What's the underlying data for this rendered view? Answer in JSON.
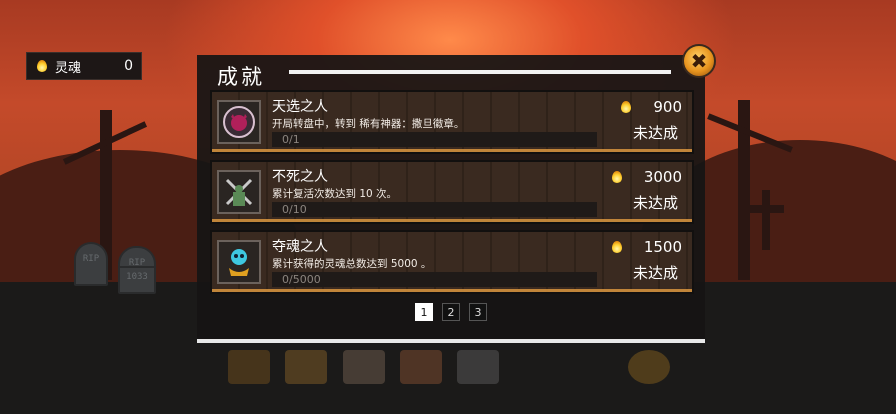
{
  "soul_counter": {
    "label": "灵魂",
    "value": "0",
    "icon": "flame-icon"
  },
  "panel": {
    "title": "成就",
    "close_icon": "close-icon",
    "close_glyph": "✖"
  },
  "achievements": [
    {
      "name": "天选之人",
      "description": "开局转盘中，转到 稀有神器：撒旦徽章。",
      "progress": "0/1",
      "reward": "900",
      "status": "未达成",
      "icon": "satan-badge-icon"
    },
    {
      "name": "不死之人",
      "description": "累计复活次数达到 10 次。",
      "progress": "0/10",
      "reward": "3000",
      "status": "未达成",
      "icon": "crossed-swords-icon"
    },
    {
      "name": "夺魂之人",
      "description": "累计获得的灵魂总数达到 5000 。",
      "progress": "0/5000",
      "reward": "1500",
      "status": "未达成",
      "icon": "soul-orb-icon"
    }
  ],
  "pagination": {
    "pages": [
      "1",
      "2",
      "3"
    ],
    "current": "1"
  },
  "background": {
    "tombstones": [
      "RIP",
      "RIP",
      "1033"
    ]
  },
  "colors": {
    "accent_gold": "#d99540",
    "panel_bg": "#161414",
    "sky_red": "#c44a2a"
  }
}
